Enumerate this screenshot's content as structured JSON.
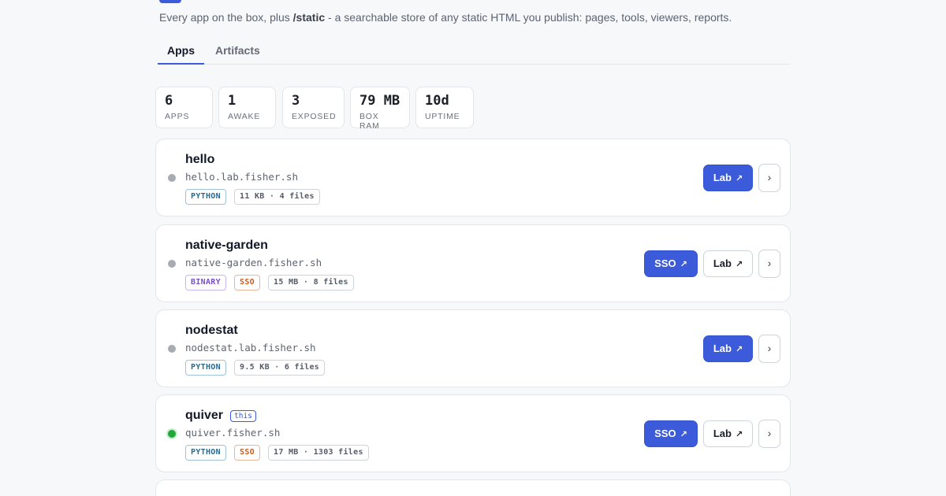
{
  "header": {
    "subtitle_prefix": "Every app on the box, plus ",
    "subtitle_bold": "/static",
    "subtitle_suffix": " - a searchable store of any static HTML you publish: pages, tools, viewers, reports."
  },
  "tabs": [
    {
      "label": "Apps",
      "active": true
    },
    {
      "label": "Artifacts",
      "active": false
    }
  ],
  "stats": [
    {
      "value": "6",
      "label": "APPS"
    },
    {
      "value": "1",
      "label": "AWAKE"
    },
    {
      "value": "3",
      "label": "EXPOSED"
    },
    {
      "value": "79 MB",
      "label": "BOX RAM"
    },
    {
      "value": "10d",
      "label": "UPTIME"
    }
  ],
  "apps": [
    {
      "name": "hello",
      "host": "hello.lab.fisher.sh",
      "tags": [
        "PYTHON"
      ],
      "size": "11 KB · 4 files",
      "buttons": [
        "Lab"
      ],
      "status": "sleeping"
    },
    {
      "name": "native-garden",
      "host": "native-garden.fisher.sh",
      "tags": [
        "BINARY",
        "SSO"
      ],
      "size": "15 MB · 8 files",
      "buttons": [
        "SSO",
        "Lab"
      ],
      "status": "sleeping"
    },
    {
      "name": "nodestat",
      "host": "nodestat.lab.fisher.sh",
      "tags": [
        "PYTHON"
      ],
      "size": "9.5 KB · 6 files",
      "buttons": [
        "Lab"
      ],
      "status": "sleeping"
    },
    {
      "name": "quiver",
      "badge": "this",
      "host": "quiver.fisher.sh",
      "tags": [
        "PYTHON",
        "SSO"
      ],
      "size": "17 MB · 1303 files",
      "buttons": [
        "SSO",
        "Lab"
      ],
      "status": "awake"
    }
  ],
  "icons": {
    "external_link": "↗",
    "chevron": "›"
  },
  "colors": {
    "accent": "#3b5bdb",
    "awake": "#22a83a",
    "sleeping": "#a7abb3"
  }
}
